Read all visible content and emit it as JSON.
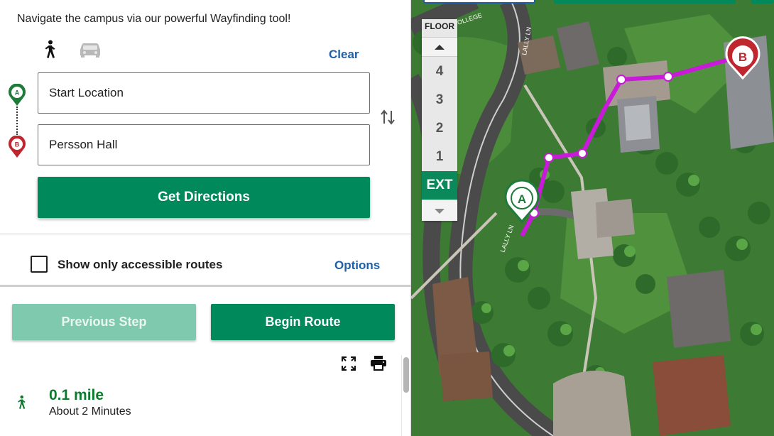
{
  "header": {
    "intro": "Navigate the campus via our powerful Wayfinding tool!"
  },
  "modes": [
    {
      "name": "walk-mode",
      "icon": "walking-person-icon",
      "active": true
    },
    {
      "name": "drive-mode",
      "icon": "car-icon",
      "active": false
    }
  ],
  "clear_label": "Clear",
  "route": {
    "start": {
      "value": "",
      "placeholder": "Start Location",
      "marker": "A"
    },
    "end": {
      "value": "Persson Hall",
      "placeholder": "",
      "marker": "B"
    }
  },
  "get_directions_label": "Get Directions",
  "accessible": {
    "label": "Show only accessible routes",
    "checked": false
  },
  "options_label": "Options",
  "steps": {
    "previous_label": "Previous Step",
    "begin_label": "Begin Route"
  },
  "summary": {
    "distance": "0.1 mile",
    "duration": "About 2 Minutes"
  },
  "map": {
    "floor_header": "FLOOR",
    "floors": [
      "4",
      "3",
      "2",
      "1",
      "EXT"
    ],
    "active_floor": "EXT",
    "road_labels": [
      "LALLY LN",
      "LALLY LN",
      "COLLEGE"
    ],
    "markers": [
      "A",
      "B"
    ]
  },
  "colors": {
    "brand_green": "#008a5c",
    "link_blue": "#1f5fa6",
    "route_magenta": "#c81ad8",
    "marker_a": "#1e7b3a",
    "marker_b": "#c0262d",
    "distance_green": "#0d7a2e"
  }
}
